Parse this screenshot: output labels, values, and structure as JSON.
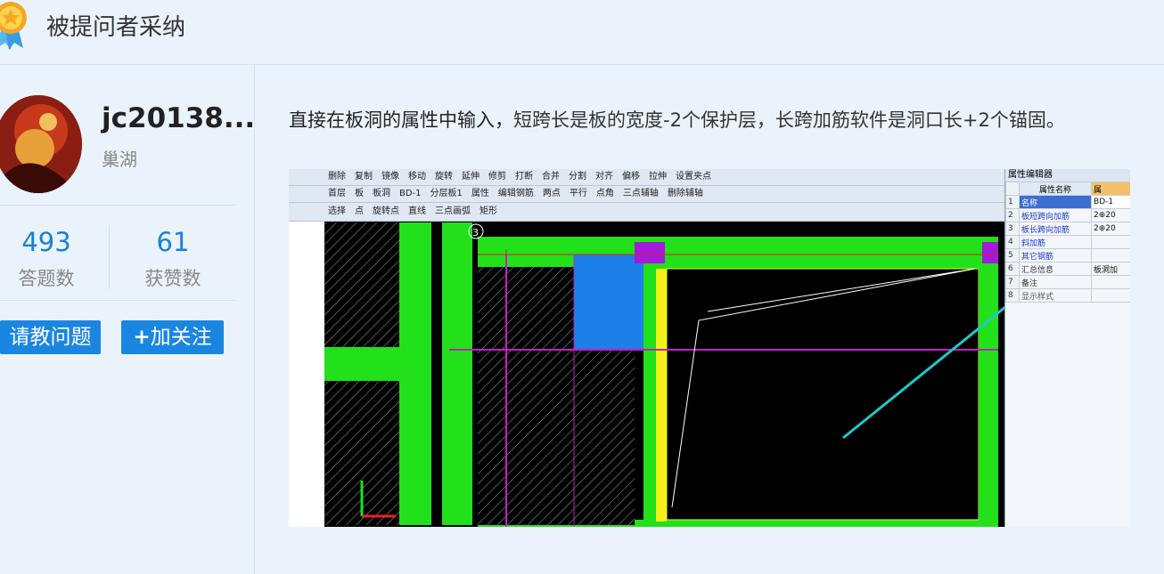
{
  "header": {
    "title": "被提问者采纳"
  },
  "profile": {
    "username": "jc20138...",
    "location": "巢湖",
    "answers_count": "493",
    "answers_label": "答题数",
    "likes_count": "61",
    "likes_label": "获赞数",
    "ask_button": "请教问题",
    "follow_button": "加关注",
    "follow_icon": "+"
  },
  "answer": {
    "lead": "直接在板洞的属性中输入，",
    "text": "短跨长是板的宽度-2个保护层，长跨加筋软件是洞口长+2个锚固。"
  },
  "screenshot": {
    "toolbar1": [
      "删除",
      "复制",
      "镜像",
      "移动",
      "旋转",
      "延伸",
      "修剪",
      "打断",
      "合并",
      "分割",
      "对齐",
      "偏移",
      "拉伸",
      "设置夹点"
    ],
    "toolbar2": [
      "首层",
      "板",
      "板洞",
      "BD-1",
      "分层板1",
      "属性",
      "编辑钢筋",
      "两点",
      "平行",
      "点角",
      "三点辅轴",
      "删除辅轴"
    ],
    "toolbar3": [
      "选择",
      "点",
      "旋转点",
      "直线",
      "三点画弧",
      "矩形"
    ],
    "panel_title": "属性编辑器",
    "panel_header": "属性名称",
    "panel_header_val": "属",
    "props": [
      {
        "num": "1",
        "name": "名称",
        "value": "BD-1"
      },
      {
        "num": "2",
        "name": "板短跨向加筋",
        "value": "2⊕20"
      },
      {
        "num": "3",
        "name": "板长跨向加筋",
        "value": "2⊕20"
      },
      {
        "num": "4",
        "name": "斜加筋",
        "value": ""
      },
      {
        "num": "5",
        "name": "其它钢筋",
        "value": ""
      },
      {
        "num": "6",
        "name": "汇总信息",
        "value": "板洞加"
      },
      {
        "num": "7",
        "name": "备注",
        "value": ""
      },
      {
        "num": "8",
        "name": "显示样式",
        "value": ""
      }
    ],
    "axis_label": "3"
  },
  "colors": {
    "accent": "#1a86e0",
    "cad_green": "#22e01a",
    "cad_blue": "#1d7fe8",
    "arrow": "#20c8c8"
  }
}
